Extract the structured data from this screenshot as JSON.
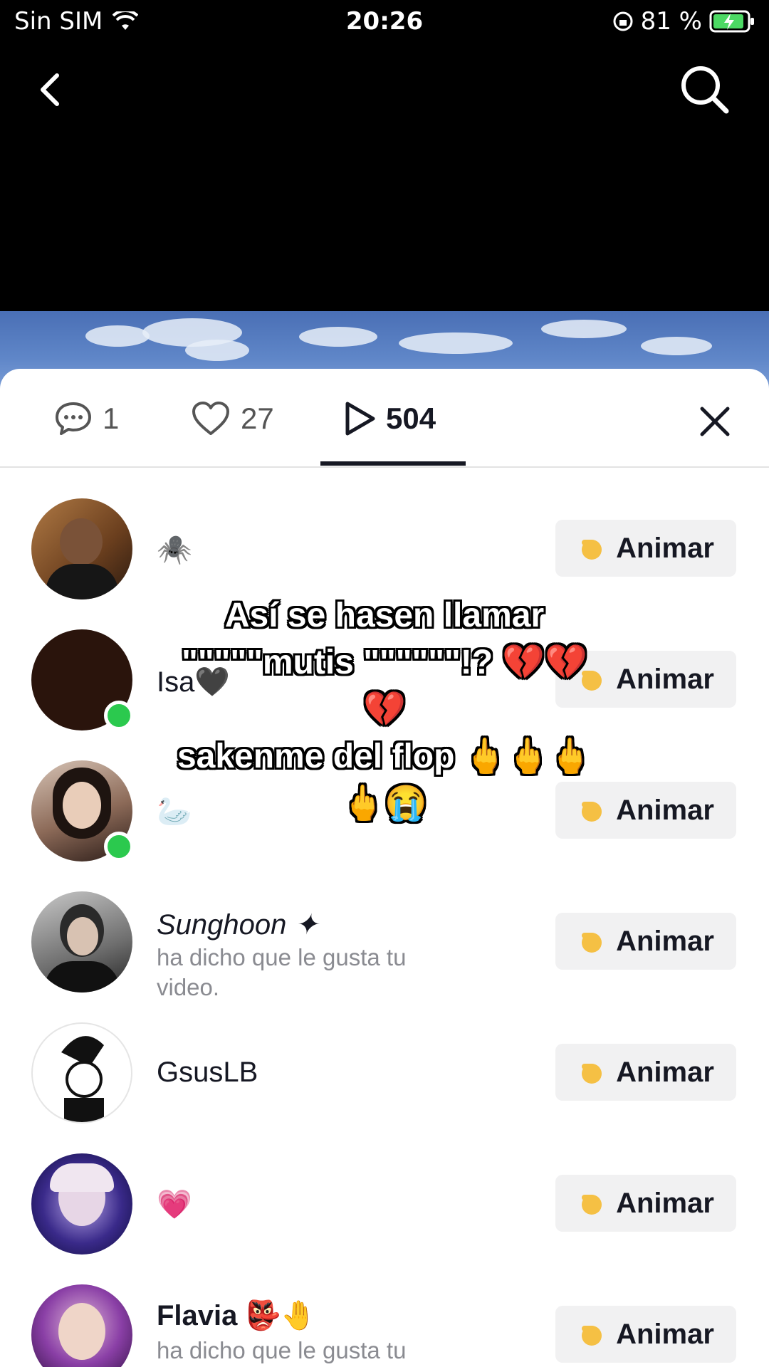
{
  "status": {
    "carrier": "Sin SIM",
    "time": "20:26",
    "battery": "81 %"
  },
  "tabs": {
    "comments": "1",
    "likes": "27",
    "views": "504"
  },
  "overlay_text": {
    "line1": "Así se hasen llamar",
    "line2": "\"\"\"\"\"mutis \"\"\"\"\"\"!? 💔💔💔",
    "line3": "sakenme del flop 🖕🖕🖕",
    "line4": "🖕😭"
  },
  "users": [
    {
      "name": "🕷️",
      "sub": "",
      "button": "Animar"
    },
    {
      "name": "Isa🖤",
      "sub": "",
      "button": "Animar"
    },
    {
      "name": "🦢",
      "sub": "",
      "button": "Animar"
    },
    {
      "name": "Sunghoon ✦",
      "sub": "ha dicho que le gusta tu video.",
      "button": "Animar"
    },
    {
      "name": "GsusLB",
      "sub": "",
      "button": "Animar"
    },
    {
      "name": "💗",
      "sub": "",
      "button": "Animar"
    },
    {
      "name": "Flavia 👺🤚",
      "sub": "ha dicho que le gusta tu video.",
      "button": "Animar"
    }
  ],
  "colors": {
    "online": "#2bc94e",
    "button_bg": "#f1f1f2",
    "text": "#161823"
  },
  "icons": [
    "wifi-icon",
    "lock-rotation-icon",
    "battery-charging-icon",
    "back-icon",
    "search-icon",
    "comment-icon",
    "heart-icon",
    "play-icon",
    "close-icon",
    "hand-wave-icon"
  ]
}
